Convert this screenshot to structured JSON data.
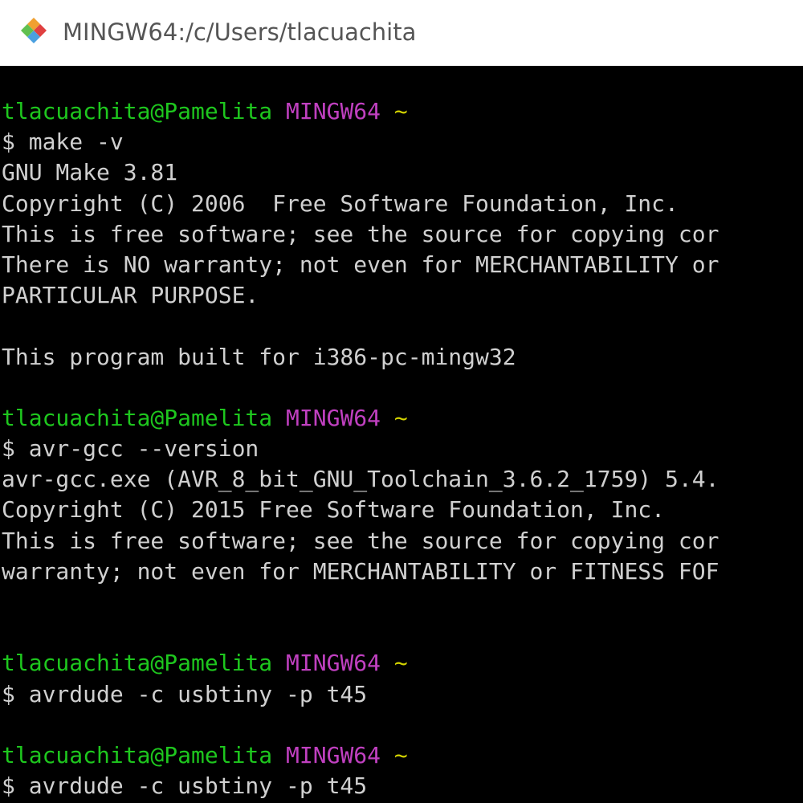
{
  "window": {
    "title": "MINGW64:/c/Users/tlacuachita",
    "icon": "git-bash-diamond-icon"
  },
  "colors": {
    "background": "#000000",
    "text": "#d0d0d0",
    "prompt_user": "#1ec71e",
    "prompt_system": "#c040c0",
    "prompt_path": "#d4d400"
  },
  "terminal": {
    "lines": [
      {
        "type": "prompt",
        "user": "tlacuachita@Pamelita",
        "system": "MINGW64",
        "path": "~"
      },
      {
        "type": "command",
        "text": "$ make -v"
      },
      {
        "type": "output",
        "text": "GNU Make 3.81"
      },
      {
        "type": "output",
        "text": "Copyright (C) 2006  Free Software Foundation, Inc."
      },
      {
        "type": "output",
        "text": "This is free software; see the source for copying cor"
      },
      {
        "type": "output",
        "text": "There is NO warranty; not even for MERCHANTABILITY or"
      },
      {
        "type": "output",
        "text": "PARTICULAR PURPOSE."
      },
      {
        "type": "blank",
        "text": ""
      },
      {
        "type": "output",
        "text": "This program built for i386-pc-mingw32"
      },
      {
        "type": "blank",
        "text": ""
      },
      {
        "type": "prompt",
        "user": "tlacuachita@Pamelita",
        "system": "MINGW64",
        "path": "~"
      },
      {
        "type": "command",
        "text": "$ avr-gcc --version"
      },
      {
        "type": "output",
        "text": "avr-gcc.exe (AVR_8_bit_GNU_Toolchain_3.6.2_1759) 5.4."
      },
      {
        "type": "output",
        "text": "Copyright (C) 2015 Free Software Foundation, Inc."
      },
      {
        "type": "output",
        "text": "This is free software; see the source for copying cor"
      },
      {
        "type": "output",
        "text": "warranty; not even for MERCHANTABILITY or FITNESS FOF"
      },
      {
        "type": "blank",
        "text": ""
      },
      {
        "type": "blank",
        "text": ""
      },
      {
        "type": "prompt",
        "user": "tlacuachita@Pamelita",
        "system": "MINGW64",
        "path": "~"
      },
      {
        "type": "command",
        "text": "$ avrdude -c usbtiny -p t45"
      },
      {
        "type": "blank",
        "text": ""
      },
      {
        "type": "prompt",
        "user": "tlacuachita@Pamelita",
        "system": "MINGW64",
        "path": "~"
      },
      {
        "type": "command",
        "text": "$ avrdude -c usbtiny -p t45"
      }
    ]
  }
}
